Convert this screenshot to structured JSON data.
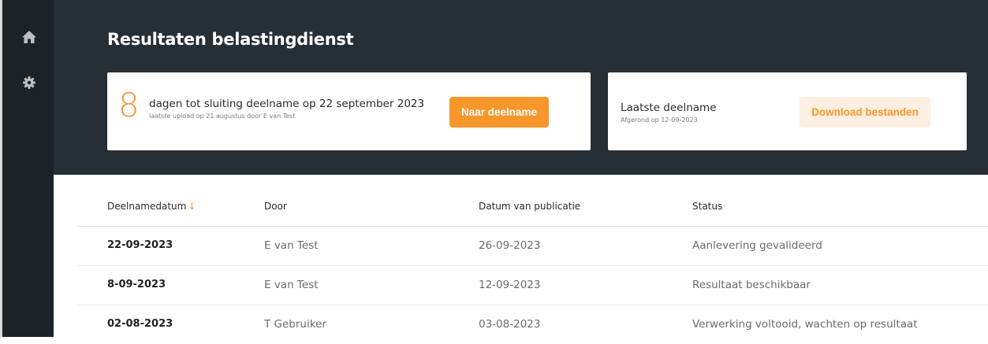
{
  "sidebar": {
    "items": [
      {
        "icon": "home-icon"
      },
      {
        "icon": "gear-icon"
      }
    ]
  },
  "header": {
    "title": "Resultaten belastingdienst"
  },
  "countdown_card": {
    "days": "8",
    "main_text": "dagen tot sluiting deelname op 22 september 2023",
    "sub_text": "laatste upload op 21 augustus door E van Test",
    "button_label": "Naar deelname"
  },
  "last_card": {
    "label": "Laatste deelname",
    "sub_text": "Afgerond op 12-09-2023",
    "button_label": "Download bestanden"
  },
  "table": {
    "headers": [
      "Deelnamedatum",
      "Door",
      "Datum van publicatie",
      "Status"
    ],
    "sort_arrow": "↓",
    "rows": [
      {
        "date": "22-09-2023",
        "by": "E van Test",
        "published": "26-09-2023",
        "status": "Aanlevering gevalideerd"
      },
      {
        "date": "8-09-2023",
        "by": "E van Test",
        "published": "12-09-2023",
        "status": "Resultaat beschikbaar"
      },
      {
        "date": "02-08-2023",
        "by": "T Gebruiker",
        "published": "03-08-2023",
        "status": "Verwerking voltooid, wachten op resultaat"
      }
    ]
  },
  "colors": {
    "accent": "#f7962a",
    "header_bg": "#262f36",
    "sidebar_bg": "#1b2329"
  }
}
